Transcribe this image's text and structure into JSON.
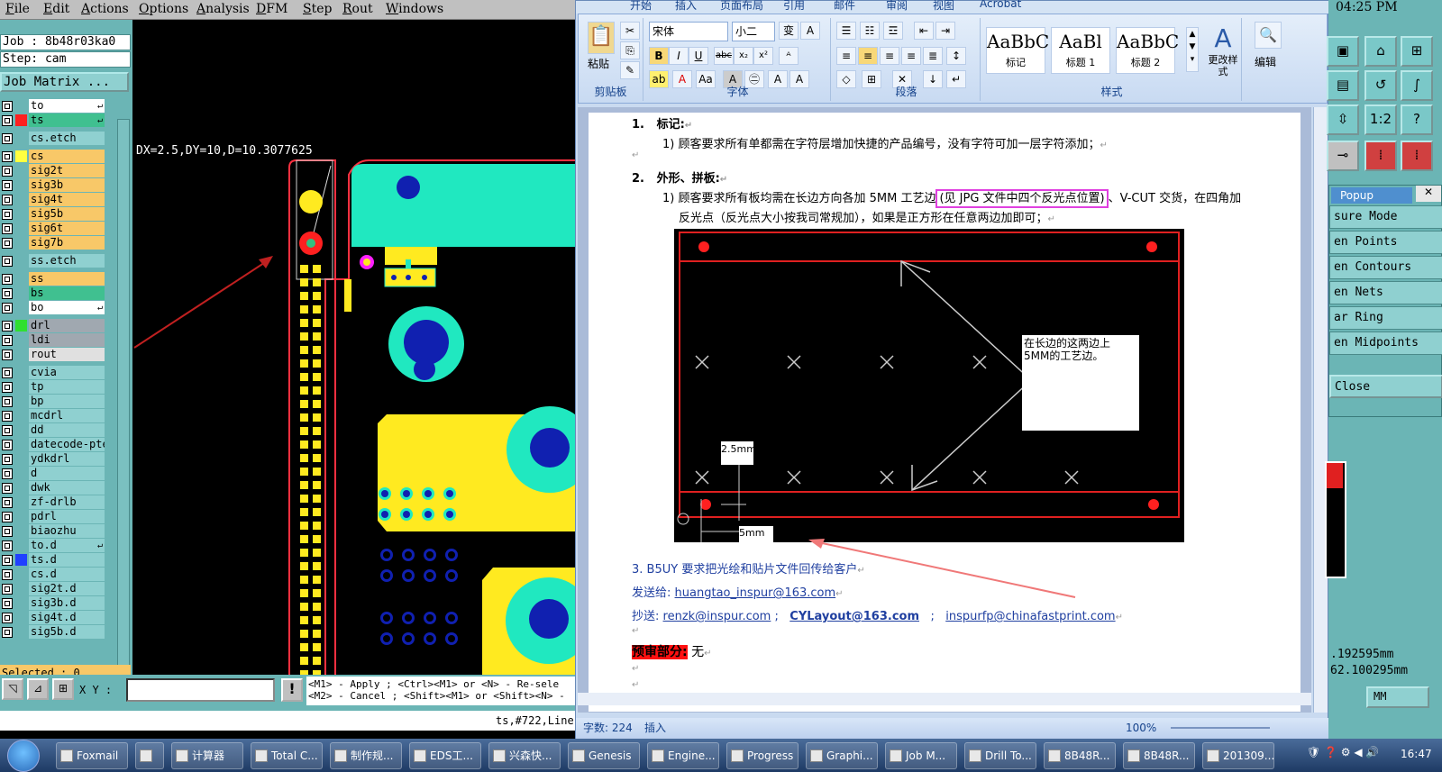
{
  "genesis": {
    "menu": [
      "File",
      "Edit",
      "Actions",
      "Options",
      "Analysis",
      "DFM",
      "Step",
      "Rout",
      "Windows"
    ],
    "job_label": "Job : 8b48r03ka0",
    "step_label": "Step: cam",
    "job_matrix": "Job Matrix ...",
    "layers": [
      {
        "name": "to",
        "color": "#ffffff",
        "swatch": "",
        "flag": "↵"
      },
      {
        "name": "ts",
        "color": "#40c090",
        "swatch": "#ff2020",
        "flag": "↵"
      },
      {
        "name": "cs.etch",
        "color": "#8fd0d0",
        "swatch": "",
        "flag": ""
      },
      {
        "name": "cs",
        "color": "#f8c868",
        "swatch": "#ffff40",
        "flag": ""
      },
      {
        "name": "sig2t",
        "color": "#f8c868",
        "swatch": "",
        "flag": ""
      },
      {
        "name": "sig3b",
        "color": "#f8c868",
        "swatch": "",
        "flag": ""
      },
      {
        "name": "sig4t",
        "color": "#f8c868",
        "swatch": "",
        "flag": ""
      },
      {
        "name": "sig5b",
        "color": "#f8c868",
        "swatch": "",
        "flag": ""
      },
      {
        "name": "sig6t",
        "color": "#f8c868",
        "swatch": "",
        "flag": ""
      },
      {
        "name": "sig7b",
        "color": "#f8c868",
        "swatch": "",
        "flag": ""
      },
      {
        "name": "ss.etch",
        "color": "#8fd0d0",
        "swatch": "",
        "flag": ""
      },
      {
        "name": "ss",
        "color": "#f8c868",
        "swatch": "",
        "flag": ""
      },
      {
        "name": "bs",
        "color": "#40c090",
        "swatch": "",
        "flag": ""
      },
      {
        "name": "bo",
        "color": "#ffffff",
        "swatch": "",
        "flag": "↵"
      },
      {
        "name": "drl",
        "color": "#a0a8b0",
        "swatch": "#30e030",
        "flag": ""
      },
      {
        "name": "ldi",
        "color": "#a0a8b0",
        "swatch": "",
        "flag": ""
      },
      {
        "name": "rout",
        "color": "#e0e0e0",
        "swatch": "",
        "flag": ""
      },
      {
        "name": "cvia",
        "color": "#8fd0d0",
        "swatch": "",
        "flag": ""
      },
      {
        "name": "tp",
        "color": "#8fd0d0",
        "swatch": "",
        "flag": ""
      },
      {
        "name": "bp",
        "color": "#8fd0d0",
        "swatch": "",
        "flag": ""
      },
      {
        "name": "mcdrl",
        "color": "#8fd0d0",
        "swatch": "",
        "flag": ""
      },
      {
        "name": "dd",
        "color": "#8fd0d0",
        "swatch": "",
        "flag": ""
      },
      {
        "name": "datecode-pte",
        "color": "#8fd0d0",
        "swatch": "",
        "flag": ""
      },
      {
        "name": "ydkdrl",
        "color": "#8fd0d0",
        "swatch": "",
        "flag": ""
      },
      {
        "name": "d",
        "color": "#8fd0d0",
        "swatch": "",
        "flag": ""
      },
      {
        "name": "dwk",
        "color": "#8fd0d0",
        "swatch": "",
        "flag": ""
      },
      {
        "name": "zf-drlb",
        "color": "#8fd0d0",
        "swatch": "",
        "flag": ""
      },
      {
        "name": "pdrl",
        "color": "#8fd0d0",
        "swatch": "",
        "flag": ""
      },
      {
        "name": "biaozhu",
        "color": "#8fd0d0",
        "swatch": "",
        "flag": ""
      },
      {
        "name": "to.d",
        "color": "#8fd0d0",
        "swatch": "",
        "flag": "↵"
      },
      {
        "name": "ts.d",
        "color": "#8fd0d0",
        "swatch": "#2040ff",
        "flag": ""
      },
      {
        "name": "cs.d",
        "color": "#8fd0d0",
        "swatch": "",
        "flag": ""
      },
      {
        "name": "sig2t.d",
        "color": "#8fd0d0",
        "swatch": "",
        "flag": ""
      },
      {
        "name": "sig3b.d",
        "color": "#8fd0d0",
        "swatch": "",
        "flag": ""
      },
      {
        "name": "sig4t.d",
        "color": "#8fd0d0",
        "swatch": "",
        "flag": ""
      },
      {
        "name": "sig5b.d",
        "color": "#8fd0d0",
        "swatch": "",
        "flag": ""
      }
    ],
    "selected": "Selected : 0",
    "measure": "DX=2.5,DY=10,D=10.3077625",
    "xy_label": "X Y :",
    "hint_line1": "<M1> - Apply  ; <Ctrl><M1> or <N> - Re-sele",
    "hint_line2": "<M2> - Cancel ; <Shift><M1> or <Shift><N> -",
    "status_line": "ts,#722,Line,",
    "clock": "04:25 PM",
    "popup_title": "Popup",
    "popup_items": [
      "sure Mode",
      "en Points",
      "en Contours",
      "en Nets",
      "ar Ring",
      "en Midpoints"
    ],
    "popup_close": "Close",
    "coord1": ".192595mm",
    "coord2": "62.100295mm",
    "units": "MM",
    "right_icons": [
      "1:2",
      "?"
    ]
  },
  "word": {
    "tabs": [
      "开始",
      "插入",
      "页面布局",
      "引用",
      "邮件",
      "审阅",
      "视图",
      "Acrobat"
    ],
    "font_name": "宋体",
    "font_size": "小二",
    "groups": {
      "clipboard": "剪贴板",
      "font": "字体",
      "paragraph": "段落",
      "styles": "样式"
    },
    "paste": "粘贴",
    "styles": [
      {
        "preview": "AaBbC",
        "label": "标记"
      },
      {
        "preview": "AaBl",
        "label": "标题 1"
      },
      {
        "preview": "AaBbC",
        "label": "标题 2"
      }
    ],
    "change_styles": "更改样式",
    "edit": "编辑",
    "doc": {
      "h1_num": "1.",
      "h1": "标记:",
      "p1": "1)  顾客要求所有单都需在字符层增加快捷的产品编号，没有字符可加一层字符添加；",
      "h2_num": "2.",
      "h2": "外形、拼板:",
      "p2a": "1)  顾客要求所有板均需在长边方向各加 5MM 工艺边",
      "p2b": "(见 JPG 文件中四个反光点位置)",
      "p2c": "、V-CUT 交货，在四角加",
      "p2d": "反光点（反光点大小按我司常规加），如果是正方形在任意两边加即可；",
      "fig_note": "在长边的这两边上 5MM的工艺边。",
      "fig_dim1": "2.5mm",
      "fig_dim2": "5mm",
      "p3": "3. B5UY 要求把光绘和贴片文件回传给客户",
      "send_label": "发送给:",
      "send_to": "huangtao_inspur@163.com",
      "cc_label": "抄送:",
      "cc1": "renzk@inspur.com",
      "cc2": "CYLayout@163.com",
      "cc3": "inspurfp@chinafastprint.com",
      "sep": ";",
      "review_label": "预审部分:",
      "review_value": "无"
    },
    "status_words": "字数: 224",
    "status_mode": "插入",
    "zoom": "100%"
  },
  "taskbar": {
    "items": [
      "Foxmail",
      "",
      "计算器",
      "Total C...",
      "制作规...",
      "EDS工...",
      "兴森快...",
      "Genesis",
      "Engine...",
      "Progress",
      "Graphi...",
      "Job M...",
      "Drill To...",
      "8B48R...",
      "8B48R...",
      "201309..."
    ],
    "time": "16:47"
  }
}
